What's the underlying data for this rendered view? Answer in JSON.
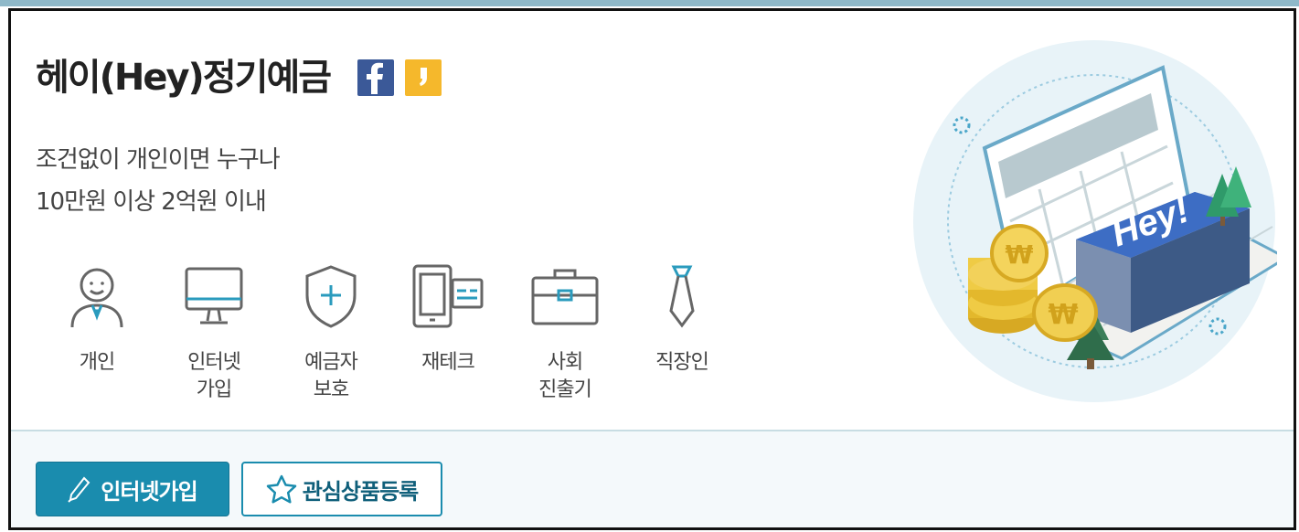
{
  "product": {
    "title": "헤이(Hey)정기예금",
    "share": {
      "facebook_icon": "facebook-icon",
      "kakaostory_icon": "kakaostory-icon"
    },
    "description": [
      "조건없이 개인이면 누구나",
      "10만원 이상 2억원 이내"
    ]
  },
  "features": [
    {
      "icon": "person-icon",
      "label": "개인"
    },
    {
      "icon": "monitor-icon",
      "label": "인터넷\n가입"
    },
    {
      "icon": "shield-icon",
      "label": "예금자\n보호"
    },
    {
      "icon": "mobile-card-icon",
      "label": "재테크"
    },
    {
      "icon": "briefcase-icon",
      "label": "사회\n진출기"
    },
    {
      "icon": "tie-icon",
      "label": "직장인"
    }
  ],
  "illustration": {
    "sign_text": "Hey!"
  },
  "actions": {
    "join_label": "인터넷가입",
    "favorite_label": "관심상품등록"
  },
  "colors": {
    "accent": "#1a8cae",
    "icon_stroke": "#666666",
    "icon_accent": "#2a9bbd",
    "facebook": "#3b5998",
    "kakaostory": "#f5b82c"
  }
}
